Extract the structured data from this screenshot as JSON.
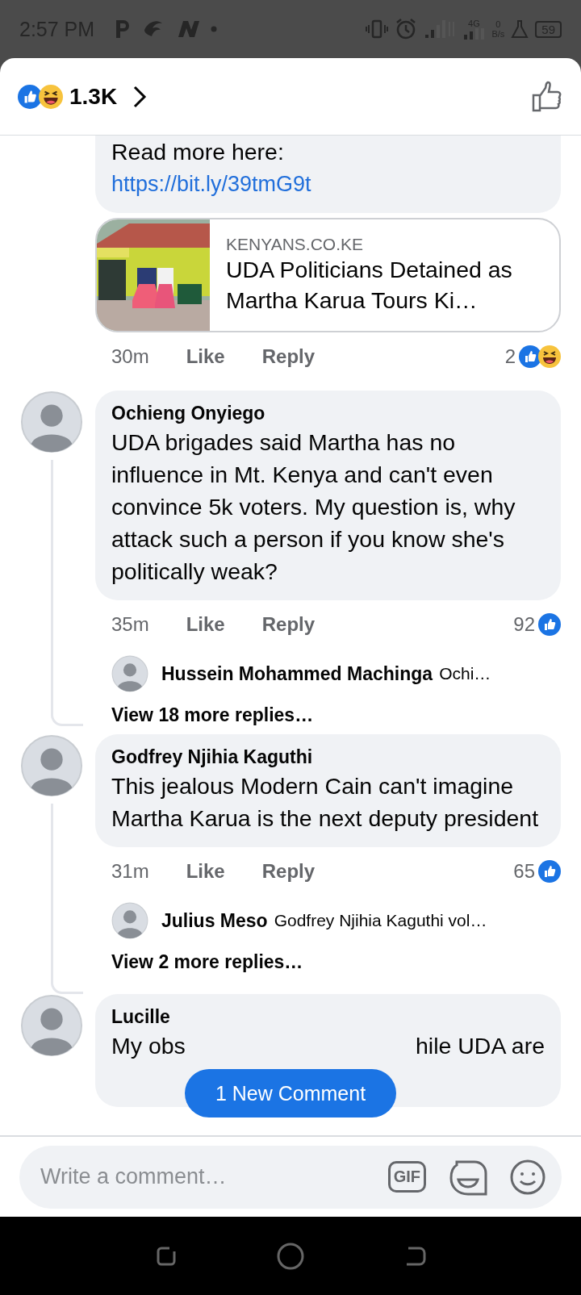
{
  "status_bar": {
    "time": "2:57 PM",
    "network": "4G",
    "speed_value": "0",
    "speed_unit": "B/s",
    "battery": "59"
  },
  "header": {
    "reaction_count": "1.3K",
    "reactions": [
      {
        "kind": "like"
      },
      {
        "kind": "haha"
      }
    ]
  },
  "comments": [
    {
      "kind": "continued",
      "text": "Read more here:",
      "link": "https://bit.ly/39tmG9t",
      "preview": {
        "domain": "KENYANS.CO.KE",
        "title": "UDA Politicians Detained as Martha Karua Tours Ki…"
      },
      "time": "30m",
      "like": "Like",
      "reply": "Reply",
      "reaction_count": "2",
      "reactions": [
        {
          "kind": "like"
        },
        {
          "kind": "haha"
        }
      ]
    },
    {
      "kind": "full",
      "author": "Ochieng Onyiego",
      "text": "UDA brigades said Martha has no influence in Mt. Kenya and can't even convince 5k voters. My question is, why attack such a person if you know she's politically weak?",
      "time": "35m",
      "like": "Like",
      "reply": "Reply",
      "reaction_count": "92",
      "reactions": [
        {
          "kind": "like"
        }
      ],
      "reply_preview": {
        "author": "Hussein Mohammed Machinga",
        "text": "Ochi…"
      },
      "view_more": "View 18 more replies…"
    },
    {
      "kind": "full",
      "author": "Godfrey Njihia Kaguthi",
      "text": "This jealous Modern Cain can't imagine Martha Karua is the next deputy president",
      "time": "31m",
      "like": "Like",
      "reply": "Reply",
      "reaction_count": "65",
      "reactions": [
        {
          "kind": "like"
        }
      ],
      "reply_preview": {
        "author": "Julius Meso",
        "text": "Godfrey Njihia Kaguthi vol…"
      },
      "view_more": "View 2 more replies…"
    },
    {
      "kind": "partial",
      "author": "Lucille",
      "text_parts": [
        "My obs",
        "hile UDA are"
      ]
    }
  ],
  "new_comment_button": "1 New Comment",
  "composer": {
    "placeholder": "Write a comment…",
    "gif_label": "GIF"
  }
}
